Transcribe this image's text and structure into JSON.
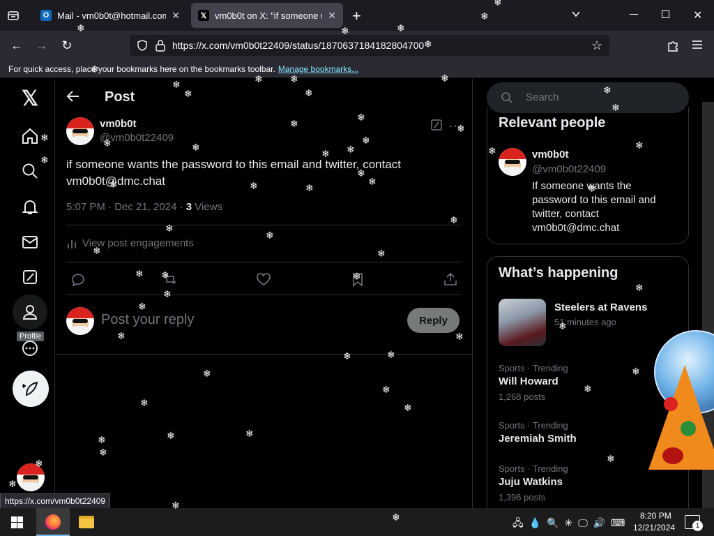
{
  "browser": {
    "tabs": [
      {
        "title": "Mail - vm0b0t@hotmail.com -",
        "favicon": "outlook-icon",
        "active": false
      },
      {
        "title": "vm0b0t on X: \"if someone want",
        "favicon": "x-icon",
        "active": true
      }
    ],
    "url": "https://x.com/vm0b0t22409/status/1870637184182804700",
    "bookmarks_bar_text": "For quick access, place your bookmarks here on the bookmarks toolbar.",
    "bookmarks_link": "Manage bookmarks...",
    "status_url": "https://x.com/vm0b0t22409"
  },
  "sidebar": {
    "profile_tooltip": "Profile",
    "icons": [
      "x-logo-icon",
      "home-icon",
      "search-icon",
      "notifications-icon",
      "messages-icon",
      "grok-icon",
      "profile-icon",
      "more-icon",
      "post-compose-icon"
    ]
  },
  "post_header": {
    "title": "Post"
  },
  "post": {
    "display_name": "vm0b0t",
    "handle": "@vm0b0t22409",
    "text": "if someone wants the password to this email and twitter, contact vm0b0t@dmc.chat",
    "timestamp": "5:07 PM · Dec 21, 2024 ·",
    "views_count": "3",
    "views_label": "Views",
    "engagements": "View post engagements"
  },
  "reply": {
    "placeholder": "Post your reply",
    "button": "Reply"
  },
  "search": {
    "placeholder": "Search"
  },
  "relevant": {
    "title": "Relevant people",
    "display_name": "vm0b0t",
    "handle": "@vm0b0t22409",
    "bio": "If someone wants the password to this email and twitter, contact vm0b0t@dmc.chat"
  },
  "happening": {
    "title": "What’s happening",
    "event": {
      "title": "Steelers at Ravens",
      "time": "51 minutes ago"
    },
    "trends": [
      {
        "context": "Sports · Trending",
        "name": "Will Howard",
        "count": "1,268 posts"
      },
      {
        "context": "Sports · Trending",
        "name": "Jeremiah Smith",
        "count": ""
      },
      {
        "context": "Sports · Trending",
        "name": "Juju Watkins",
        "count": "1,396 posts"
      }
    ]
  },
  "taskbar": {
    "time": "8:20 PM",
    "date": "12/21/2024",
    "notifications": "1"
  },
  "colors": {
    "accent": "#1d9bf0",
    "background": "#000000",
    "border": "#2f3336",
    "muted": "#71767b"
  }
}
